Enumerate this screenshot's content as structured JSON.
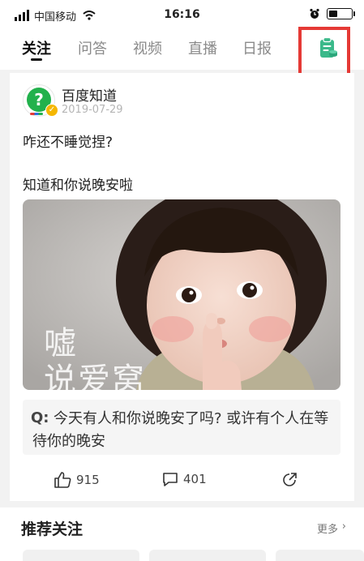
{
  "status_bar": {
    "carrier": "中国移动",
    "time": "16:16",
    "battery_level": 0.4
  },
  "nav": {
    "tabs": [
      {
        "label": "关注",
        "active": true
      },
      {
        "label": "问答",
        "active": false
      },
      {
        "label": "视频",
        "active": false
      },
      {
        "label": "直播",
        "active": false
      },
      {
        "label": "日报",
        "active": false
      }
    ],
    "icon": "document-icon"
  },
  "post": {
    "author": "百度知道",
    "date": "2019-07-29",
    "text": "咋还不睡觉捏?",
    "text2": "知道和你说晚安啦",
    "image_overlay_line1": "嘘",
    "image_overlay_line2": "说爱窝",
    "question_prefix": "Q:",
    "question": "今天有人和你说晚安了吗? 或许有个人在等待你的晚安",
    "likes": "915",
    "comments": "401"
  },
  "section": {
    "title": "推荐关注",
    "more": "更多"
  },
  "colors": {
    "accent_green": "#22b14c",
    "highlight_red": "#e53935"
  }
}
